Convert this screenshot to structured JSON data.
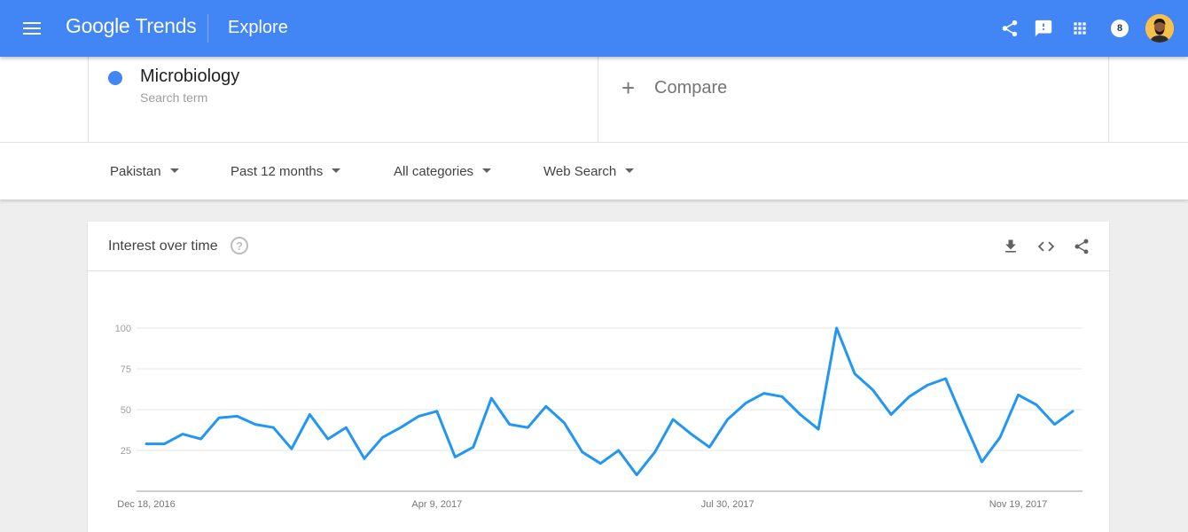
{
  "header": {
    "logo_google": "Google",
    "logo_trends": "Trends",
    "page_name": "Explore",
    "notification_count": "8",
    "icons": [
      "menu-icon",
      "share-icon",
      "feedback-icon",
      "apps-icon",
      "notifications-badge",
      "account-avatar"
    ]
  },
  "search_term": {
    "name": "Microbiology",
    "subtitle": "Search term",
    "color": "#4285f4"
  },
  "compare": {
    "plus": "+",
    "label": "Compare"
  },
  "filters": {
    "region": "Pakistan",
    "time": "Past 12 months",
    "category": "All categories",
    "search_type": "Web Search"
  },
  "card": {
    "title": "Interest over time",
    "help_symbol": "?",
    "icons": [
      "download-icon",
      "embed-icon",
      "share-icon"
    ]
  },
  "chart_data": {
    "type": "line",
    "title": "Interest over time",
    "ylim": [
      0,
      100
    ],
    "y_ticks": [
      "25",
      "50",
      "75",
      "100"
    ],
    "x_tick_labels": [
      "Dec 18, 2016",
      "Apr 9, 2017",
      "Jul 30, 2017",
      "Nov 19, 2017"
    ],
    "grid": true,
    "series": [
      {
        "name": "Microbiology",
        "color": "#2196f3",
        "values": [
          29,
          29,
          35,
          32,
          45,
          46,
          41,
          39,
          26,
          47,
          32,
          39,
          20,
          33,
          39,
          46,
          49,
          21,
          27,
          57,
          41,
          39,
          52,
          42,
          24,
          17,
          25,
          10,
          24,
          44,
          35,
          27,
          44,
          54,
          60,
          58,
          47,
          38,
          100,
          72,
          62,
          47,
          58,
          65,
          69,
          43,
          18,
          33,
          59,
          53,
          41,
          49
        ]
      }
    ]
  }
}
